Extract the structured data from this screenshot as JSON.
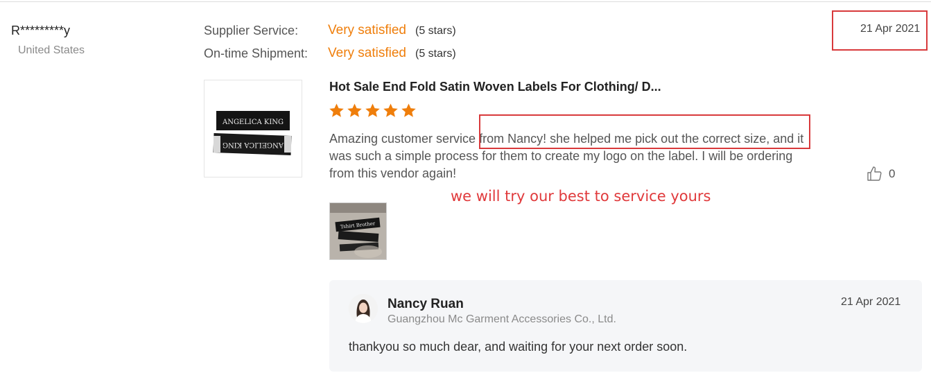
{
  "reviewer": {
    "name": "R*********y",
    "country": "United States"
  },
  "ratings": [
    {
      "label": "Supplier Service:",
      "value": "Very satisfied",
      "stars": "(5 stars)"
    },
    {
      "label": "On-time Shipment:",
      "value": "Very satisfied",
      "stars": "(5 stars)"
    }
  ],
  "review_date": "21 Apr 2021",
  "product": {
    "title": "Hot Sale End Fold Satin Woven Labels For Clothing/ D...",
    "label_text": "ANGELICA KING",
    "star_rating": 5
  },
  "review_text": "Amazing customer service from Nancy! she helped me pick out the correct size, and it was such a simple process for them to create my logo on the label. I will be ordering from this vendor again!",
  "annotation": "we will try our best to service yours",
  "likes": {
    "count": "0",
    "icon": "thumbs-up-icon"
  },
  "photo": {
    "top_text": "Tshirt Brother"
  },
  "reply": {
    "name": "Nancy Ruan",
    "company": "Guangzhou Mc Garment Accessories Co., Ltd.",
    "date": "21 Apr 2021",
    "text": "thankyou so much dear, and waiting for your next order soon."
  },
  "colors": {
    "accent": "#ef7e0b",
    "highlight": "#d8393b",
    "reply_bg": "#f5f6f8"
  }
}
